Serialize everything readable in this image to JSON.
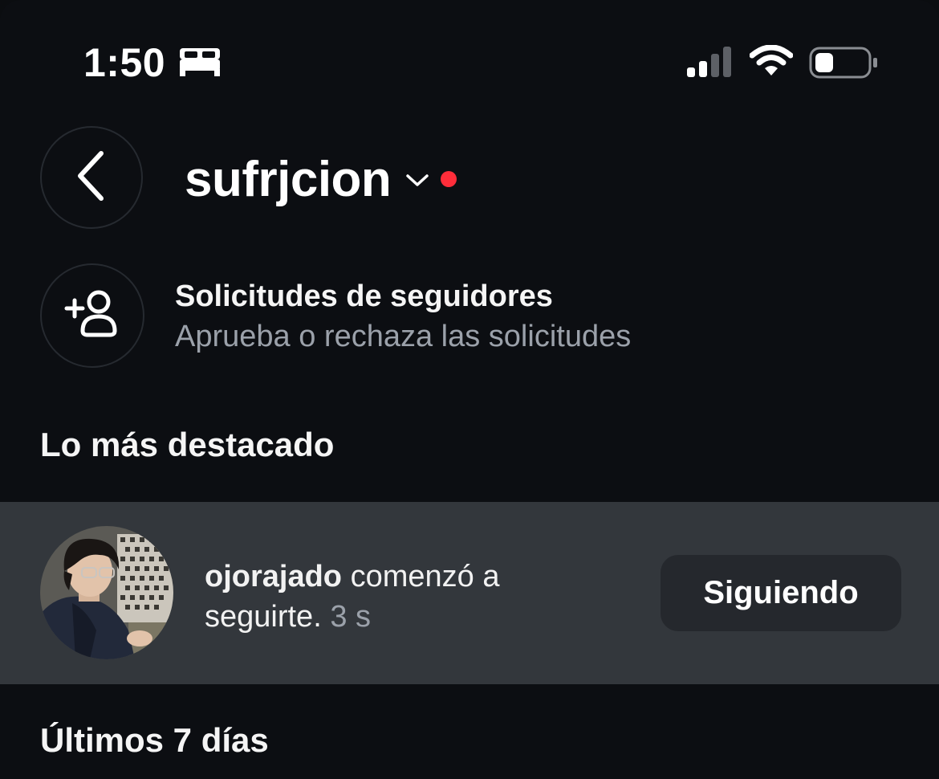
{
  "status_bar": {
    "time": "1:50",
    "sleep_icon": "bed-icon",
    "signal_icon": "cellular-signal-icon",
    "wifi_icon": "wifi-icon",
    "battery_icon": "battery-icon",
    "battery_level": 0.3
  },
  "header": {
    "back_icon": "chevron-left-icon",
    "account_name": "sufrjcion",
    "dropdown_icon": "chevron-down-icon",
    "has_unread_indicator": true
  },
  "follow_requests": {
    "icon": "add-person-icon",
    "title": "Solicitudes de seguidores",
    "subtitle": "Aprueba o rechaza las solicitudes"
  },
  "sections": {
    "highlights_title": "Lo más destacado",
    "last7_title": "Últimos 7 días"
  },
  "highlight_item": {
    "username": "ojorajado",
    "message_part1": " comenzó a",
    "message_part2": "seguirte.",
    "time": "3 s",
    "button_label": "Siguiendo"
  },
  "colors": {
    "background": "#0c0e12",
    "highlight_background": "#33373c",
    "button_background": "#25282d",
    "secondary_text": "#9ba1aa",
    "unread_dot": "#ff2d3a"
  }
}
